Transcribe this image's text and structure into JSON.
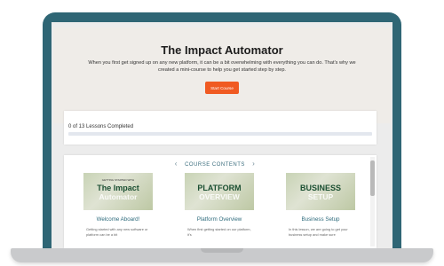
{
  "hero": {
    "title": "The Impact Automator",
    "text": "When you first get signed up on any new platform, it can be a bit overwhelming with everything you can do. That's why we created a mini-course to help you get started step by step.",
    "start_button": "Start Course"
  },
  "progress": {
    "label": "0 of 13 Lessons Completed",
    "completed": 0,
    "total": 13
  },
  "contents": {
    "heading": "COURSE CONTENTS",
    "prev_icon": "chevron-left-icon",
    "next_icon": "chevron-right-icon",
    "lessons": [
      {
        "thumb_title": "The Impact",
        "thumb_sub": "Automator",
        "thumb_kicker": "GETTING STARTED WITH",
        "title": "Welcome Aboard!",
        "desc": "Getting started with any new software or platform can be a bit"
      },
      {
        "thumb_title": "PLATFORM",
        "thumb_sub": "OVERVIEW",
        "thumb_kicker": "",
        "title": "Platform Overview",
        "desc": "When first getting started on our platform, it's"
      },
      {
        "thumb_title": "BUSINESS",
        "thumb_sub": "SETUP",
        "thumb_kicker": "",
        "title": "Business Setup",
        "desc": "In this lesson, we are going to get your business setup and make sure"
      }
    ]
  },
  "colors": {
    "laptop_frame": "#2f6675",
    "accent_button": "#f05a22",
    "lesson_title": "#2e6b7c"
  }
}
